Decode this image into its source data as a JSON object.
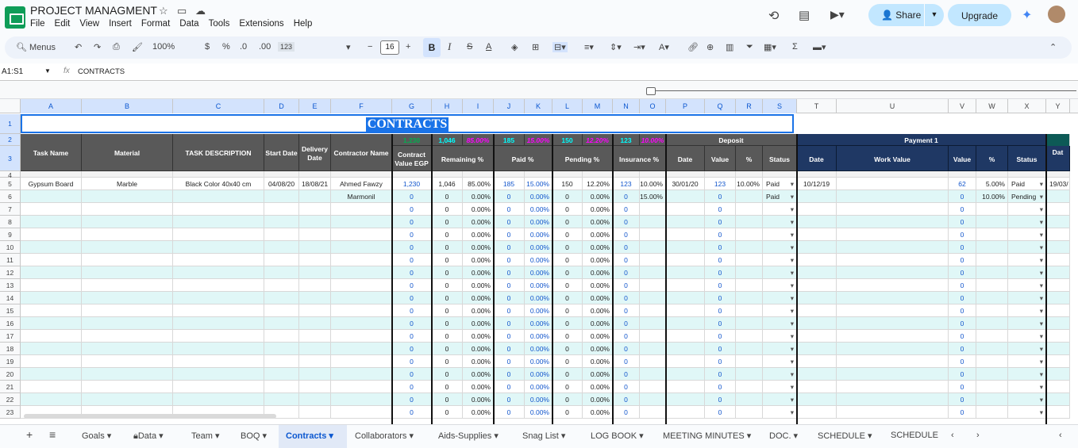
{
  "app": {
    "title": "PROJECT MANAGMENT",
    "menu": [
      "File",
      "Edit",
      "View",
      "Insert",
      "Format",
      "Data",
      "Tools",
      "Extensions",
      "Help"
    ],
    "share_label": "Share",
    "upgrade_label": "Upgrade"
  },
  "toolbar": {
    "menus_label": "Menus",
    "zoom": "100%",
    "currency": "$",
    "percent": "%",
    "dec_minus": ".0",
    "dec_plus": ".00",
    "format_123": "123",
    "font_size": "16",
    "bold": "B",
    "italic": "I",
    "sigma": "Σ"
  },
  "formula_bar": {
    "name_box": "A1:S1",
    "fx": "fx",
    "formula": "CONTRACTS"
  },
  "columns": [
    "A",
    "B",
    "C",
    "D",
    "E",
    "F",
    "G",
    "H",
    "I",
    "J",
    "K",
    "L",
    "M",
    "N",
    "O",
    "P",
    "Q",
    "R",
    "S",
    "T",
    "U",
    "V",
    "W",
    "X",
    "Y"
  ],
  "row_numbers": [
    "1",
    "2",
    "3",
    "4",
    "5",
    "6",
    "7",
    "8",
    "9",
    "10",
    "11",
    "12",
    "13",
    "14",
    "15",
    "16",
    "17",
    "18",
    "19",
    "20",
    "21",
    "22",
    "23"
  ],
  "sheet": {
    "title": "CONTRACTS",
    "headers": {
      "task_name": "Task Name",
      "material": "Material",
      "task_description": "TASK DESCRIPTION",
      "start_date": "Start Date",
      "delivery_date": "Delivery Date",
      "contractor_name": "Contractor Name",
      "contract_value": "Contract Value EGP",
      "remaining": "Remaining  %",
      "paid": "Paid %",
      "pending": "Pending %",
      "insurance": "Insurance %",
      "deposit": "Deposit",
      "date": "Date",
      "value": "Value",
      "pct": "%",
      "status": "Status",
      "payment1": "Payment 1",
      "work_value": "Work Value",
      "date_partial": "Dat"
    },
    "totals": {
      "contract": "1,230",
      "remaining": "1,046",
      "remaining_pct": "85.00%",
      "paid": "185",
      "paid_pct": "15.00%",
      "pending": "150",
      "pending_pct": "12.20%",
      "insurance": "123",
      "insurance_pct": "10.00%"
    },
    "row5": {
      "task": "Gypsum Board",
      "material": "Marble",
      "desc": "Black Color 40x40 cm",
      "start": "04/08/20",
      "delivery": "18/08/21",
      "contractor": "Ahmed Fawzy",
      "contract": "1,230",
      "remaining": "1,046",
      "remaining_pct": "85.00%",
      "paid": "185",
      "paid_pct": "15.00%",
      "pending": "150",
      "pending_pct": "12.20%",
      "insurance": "123",
      "insurance_pct": "10.00%",
      "dep_date": "30/01/20",
      "dep_value": "123",
      "dep_pct": "10.00%",
      "dep_status": "Paid",
      "p1_date": "10/12/19",
      "p1_value": "62",
      "p1_pct": "5.00%",
      "p1_status": "Paid",
      "p2_date": "19/03/"
    },
    "row6": {
      "contractor": "Marmonil",
      "insurance_pct": "15.00%",
      "dep_status": "Paid",
      "p1_pct": "10.00%",
      "p1_status": "Pending"
    },
    "zero": "0",
    "zero_pct": "0.00%"
  },
  "tabs": [
    "Goals",
    "Data",
    "Team",
    "BOQ",
    "Contracts",
    "Collaborators",
    "Aids-Supplies",
    "Snag List",
    "LOG BOOK",
    "MEETING MINUTES",
    "DOC.",
    "SCHEDULE",
    "SCHEDULE"
  ],
  "active_tab": "Contracts",
  "colors": {
    "header_dark": "#595959",
    "header_navy": "#1f3864",
    "row_alt": "#e0f7f7",
    "value_blue": "#1155cc",
    "green_total": "#00b050",
    "magenta_pct": "#ff00ff",
    "cyan_total": "#00ffff"
  }
}
